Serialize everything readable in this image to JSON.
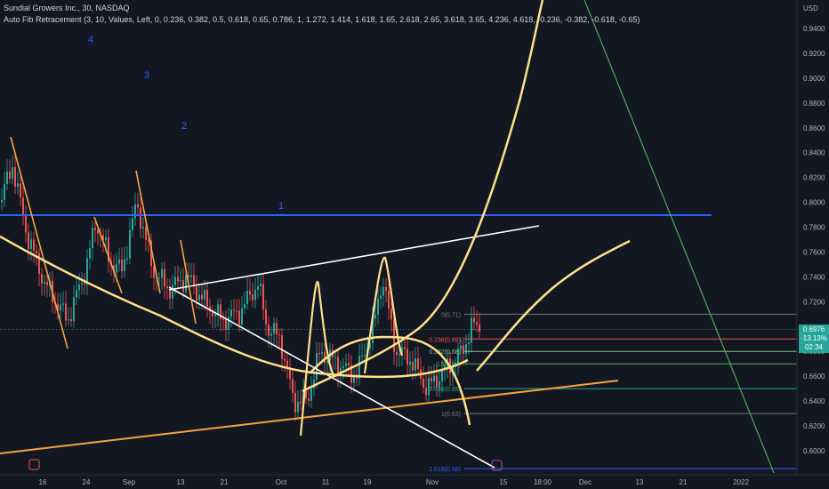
{
  "header": {
    "symbol_line": "Sundial Growers Inc., 30, NASDAQ",
    "indicator_line": "Auto Fib Retracement (3, 10, Values, Left, 0, 0.236, 0.382, 0.5, 0.618, 0.65, 0.786, 1, 1.272, 1.414, 1.618, 1.65, 2.618, 2.65, 3.618, 3.65, 4.236, 4.618, -0.236, -0.382, -0.618, -0.65)"
  },
  "price_tag": {
    "price": "0.6976",
    "change": "-13.13%",
    "countdown": "02:34"
  },
  "colors": {
    "background": "#131722",
    "up": "#26a69a",
    "down": "#ef5350",
    "wave_labels": "#2962ff",
    "resistance": "#2962ff",
    "arc": "#ffe08a",
    "trend_orange": "#f7a440",
    "trend_white": "#ffffff",
    "projection_green": "#4caf50"
  },
  "chart_data": {
    "type": "candlestick",
    "symbol": "Sundial Growers Inc.",
    "interval": "30",
    "exchange": "NASDAQ",
    "currency": "USD",
    "y_axis": {
      "unit": "USD",
      "range": [
        0.58,
        0.963
      ],
      "tick_labels": [
        "0.9400",
        "0.9200",
        "0.9000",
        "0.8800",
        "0.8600",
        "0.8400",
        "0.8200",
        "0.8000",
        "0.7800",
        "0.7600",
        "0.7400",
        "0.7200",
        "0.6800",
        "0.6600",
        "0.6400",
        "0.6200",
        "0.6000"
      ]
    },
    "x_axis": {
      "tick_labels": [
        "16",
        "24",
        "Sep",
        "13",
        "21",
        "Oct",
        "11",
        "19",
        "Nov",
        "15",
        "18:00",
        "Dec",
        "13",
        "21",
        "2022"
      ]
    },
    "last_price": 0.6976,
    "change_percent": "-13.13%",
    "fib_levels": [
      {
        "label": "0(0.71)",
        "price": 0.71
      },
      {
        "label": "0.236(0.69)",
        "price": 0.69
      },
      {
        "label": "0.382(0.68)",
        "price": 0.68
      },
      {
        "label": "0.5(0.67)",
        "price": 0.67
      },
      {
        "label": "0.786(0.65)",
        "price": 0.65
      },
      {
        "label": "1(0.63)",
        "price": 0.63
      },
      {
        "label": "1.618(0.58)",
        "price": 0.58
      }
    ],
    "wave_labels": [
      "1",
      "2",
      "3",
      "4"
    ],
    "horizontal_levels": [
      0.79
    ]
  }
}
